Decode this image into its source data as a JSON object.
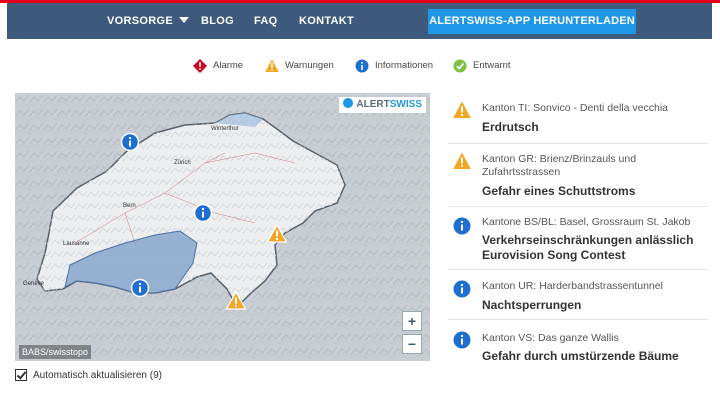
{
  "nav": {
    "items": [
      "VORSORGE",
      "BLOG",
      "FAQ",
      "KONTAKT"
    ],
    "app_button": "ALERTSWISS-APP HERUNTERLADEN"
  },
  "legend": {
    "items": [
      {
        "label": "Alarme",
        "icon": "alarm-diamond-icon",
        "color": "#d0021b"
      },
      {
        "label": "Warnungen",
        "icon": "warning-triangle-icon",
        "color": "#f5a623"
      },
      {
        "label": "Informationen",
        "icon": "info-circle-icon",
        "color": "#1e6fd0"
      },
      {
        "label": "Entwarnt",
        "icon": "check-circle-icon",
        "color": "#7ac142"
      }
    ]
  },
  "map": {
    "brand_prefix": "ALERT",
    "brand_suffix": "SWISS",
    "attribution": "BABS/swisstopo",
    "zoom_in": "+",
    "zoom_out": "−",
    "places": [
      "Winterthur",
      "Zürich",
      "Bern",
      "Lausanne",
      "Genève"
    ]
  },
  "entries": [
    {
      "type": "warning",
      "region": "Kanton TI: Sonvico - Denti della vecchia",
      "title": "Erdrutsch"
    },
    {
      "type": "warning",
      "region": "Kanton GR: Brienz/Brinzauls und Zufahrtsstrassen",
      "title": "Gefahr eines Schuttstroms"
    },
    {
      "type": "info",
      "region": "Kantone BS/BL: Basel, Grossraum St. Jakob",
      "title": "Verkehrseinschränkungen anlässlich Eurovision Song Contest"
    },
    {
      "type": "info",
      "region": "Kanton UR: Harderbandstrassentunnel",
      "title": "Nachtsperrungen"
    },
    {
      "type": "info",
      "region": "Kanton VS: Das ganze Wallis",
      "title": "Gefahr durch umstürzende Bäume"
    }
  ],
  "auto_update": {
    "label": "Automatisch aktualisieren",
    "count": "(9)"
  },
  "colors": {
    "nav": "#3e5a7c",
    "accent": "#1e98e6",
    "topline": "#e2001a"
  }
}
